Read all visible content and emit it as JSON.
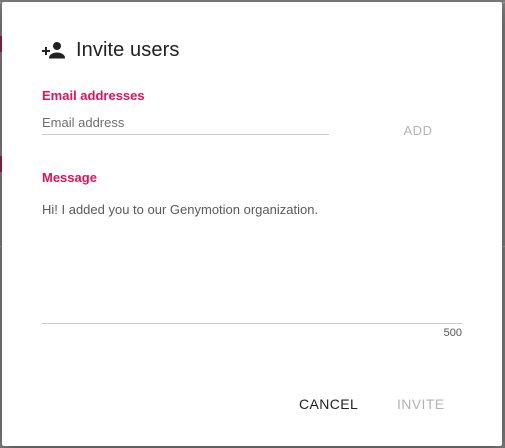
{
  "dialog": {
    "title": "Invite users",
    "title_icon": "person-add-icon",
    "email": {
      "label": "Email addresses",
      "placeholder": "Email address",
      "value": "",
      "add_label": "ADD"
    },
    "message": {
      "label": "Message",
      "value": "Hi! I added you to our Genymotion organization.",
      "char_count": "500"
    },
    "actions": {
      "cancel_label": "CANCEL",
      "invite_label": "INVITE"
    }
  },
  "colors": {
    "accent": "#e0115f",
    "disabled": "#b3b3b3",
    "backdrop_accent": "#8d2547"
  }
}
